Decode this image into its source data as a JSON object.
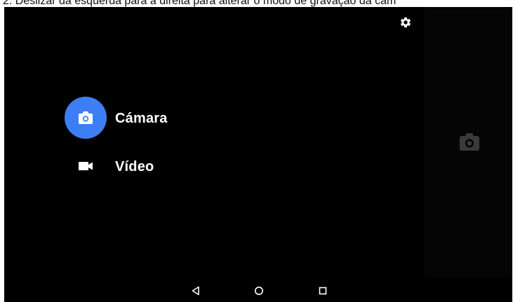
{
  "caption": {
    "text": "2. Deslizar da esquerda para a direita para alterar o modo de gravação da câm"
  },
  "top_bar": {
    "settings_icon": "gear-icon"
  },
  "mode_menu": {
    "items": [
      {
        "label": "Cámara",
        "icon": "camera-icon",
        "selected": true
      },
      {
        "label": "Vídeo",
        "icon": "video-camera-icon",
        "selected": false
      }
    ],
    "accent_color": "#3d7ef5"
  },
  "preview": {
    "icon": "camera-icon"
  },
  "nav_bar": {
    "buttons": [
      "back-icon",
      "home-icon",
      "recents-icon"
    ]
  },
  "colors": {
    "background": "#000000",
    "accent": "#3d7ef5",
    "text": "#ffffff",
    "icon_dim": "#3a3a3a"
  }
}
